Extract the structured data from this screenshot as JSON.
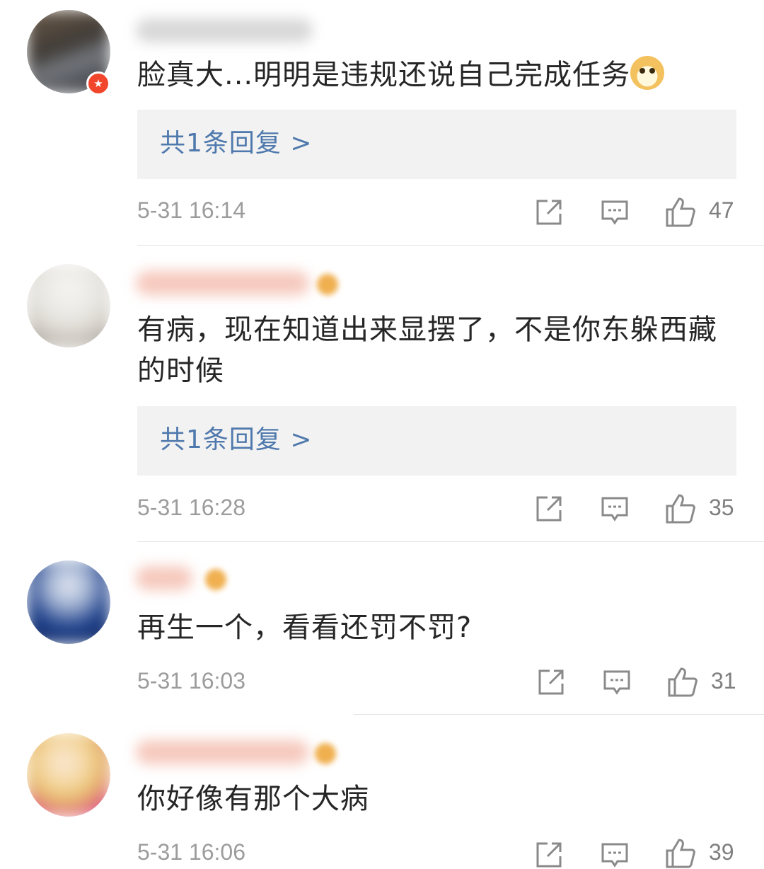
{
  "comments": [
    {
      "text": "脸真大...明明是违规还说自己完成任务",
      "emoji": "doge-emoji",
      "reply_label": "共1条回复 >",
      "timestamp": "5-31 16:14",
      "likes": "47"
    },
    {
      "text": "有病，现在知道出来显摆了，不是你东躲西藏的时候",
      "reply_label": "共1条回复 >",
      "timestamp": "5-31 16:28",
      "likes": "35"
    },
    {
      "text": "再生一个，看看还罚不罚?",
      "timestamp": "5-31 16:03",
      "likes": "31"
    },
    {
      "text": "你好像有那个大病",
      "timestamp": "5-31 16:06",
      "likes": "39"
    }
  ],
  "icons": {
    "repost": "repost-icon",
    "comment": "comment-icon",
    "like": "thumbs-up-icon",
    "badge": "verified-star-icon"
  },
  "colors": {
    "reply_link": "#4f79ad",
    "reply_bg": "#f2f2f2",
    "meta_text": "#9c9c9c",
    "badge": "#f1462c"
  }
}
